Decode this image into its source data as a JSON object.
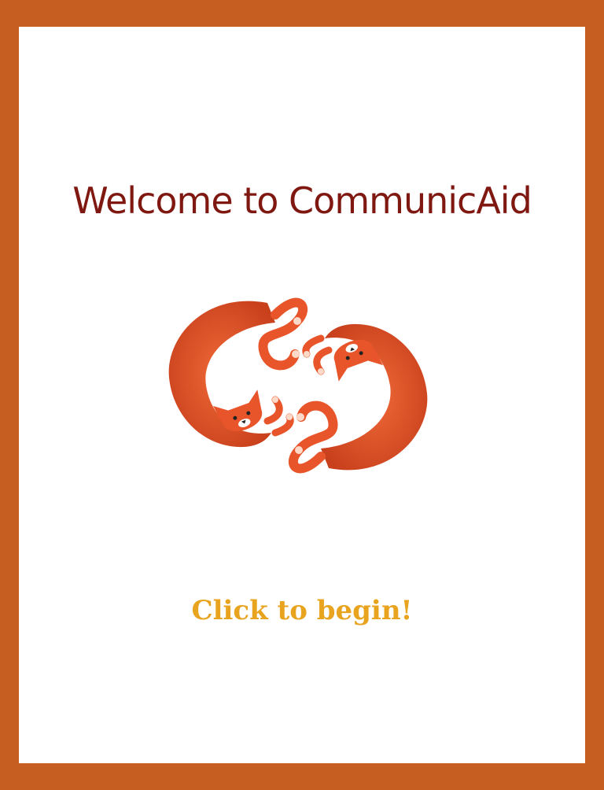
{
  "screen": {
    "title": "Welcome to CommunicAid",
    "cta_label": "Click to begin!"
  },
  "logo": {
    "icon": "two-curled-cats-icon",
    "cat_color": "#e8552a",
    "paw_color": "#ffd9c8"
  },
  "colors": {
    "frame": "#c65e22",
    "background": "#ffffff",
    "title": "#801812",
    "cta": "#e8a41e"
  }
}
